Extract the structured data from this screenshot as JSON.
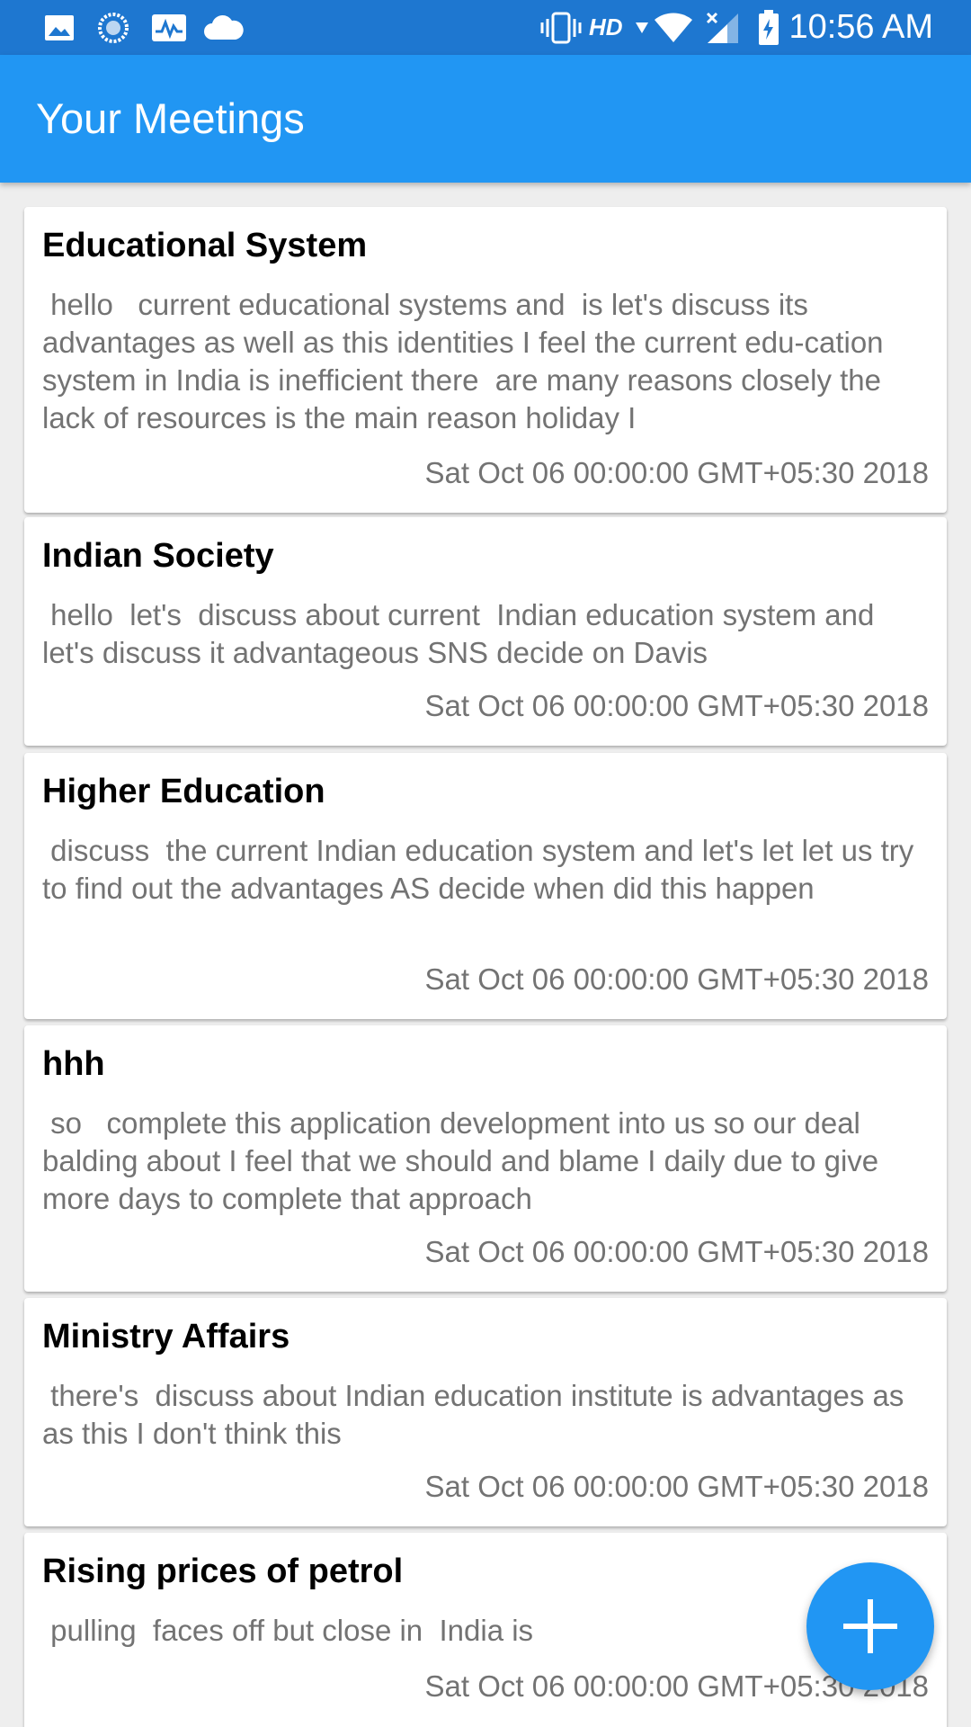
{
  "status_bar": {
    "time": "10:56 AM",
    "network_label": "HD",
    "icons": [
      "image-icon",
      "sync-icon",
      "activity-icon",
      "cloud-icon",
      "vibrate-icon",
      "wifi-icon",
      "signal-icon",
      "battery-icon"
    ]
  },
  "app_bar": {
    "title": "Your Meetings"
  },
  "meetings": [
    {
      "title": "Educational System",
      "body": " hello   current educational systems and  is let's discuss its advantages as well as this identities I feel the current edu-cation system in India is inefficient there  are many reasons closely the lack of resources is the main reason holiday I",
      "date": "Sat Oct 06 00:00:00 GMT+05:30 2018"
    },
    {
      "title": "Indian Society",
      "body": " hello  let's  discuss about current  Indian education system and let's discuss it advantageous SNS decide on Davis",
      "date": "Sat Oct 06 00:00:00 GMT+05:30 2018"
    },
    {
      "title": "Higher Education",
      "body": " discuss  the current Indian education system and let's let let us try to find out the advantages AS decide when did this happen",
      "date": "Sat Oct 06 00:00:00 GMT+05:30 2018"
    },
    {
      "title": "hhh",
      "body": " so   complete this application development into us so our deal balding about I feel that we should and blame I daily due to give more days to complete that approach",
      "date": "Sat Oct 06 00:00:00 GMT+05:30 2018"
    },
    {
      "title": "Ministry Affairs",
      "body": " there's  discuss about Indian education institute is advantages as as this I don't think this",
      "date": "Sat Oct 06 00:00:00 GMT+05:30 2018"
    },
    {
      "title": "Rising prices of petrol",
      "body": " pulling  faces off but close in  India is",
      "date": "Sat Oct 06 00:00:00 GMT+05:30 2018"
    }
  ],
  "fab": {
    "icon": "plus-icon"
  },
  "colors": {
    "status_bar": "#1e77d0",
    "app_bar": "#2196f3",
    "fab": "#2196f3",
    "background": "#eeeeee",
    "card": "#ffffff",
    "secondary_text": "#737373"
  }
}
